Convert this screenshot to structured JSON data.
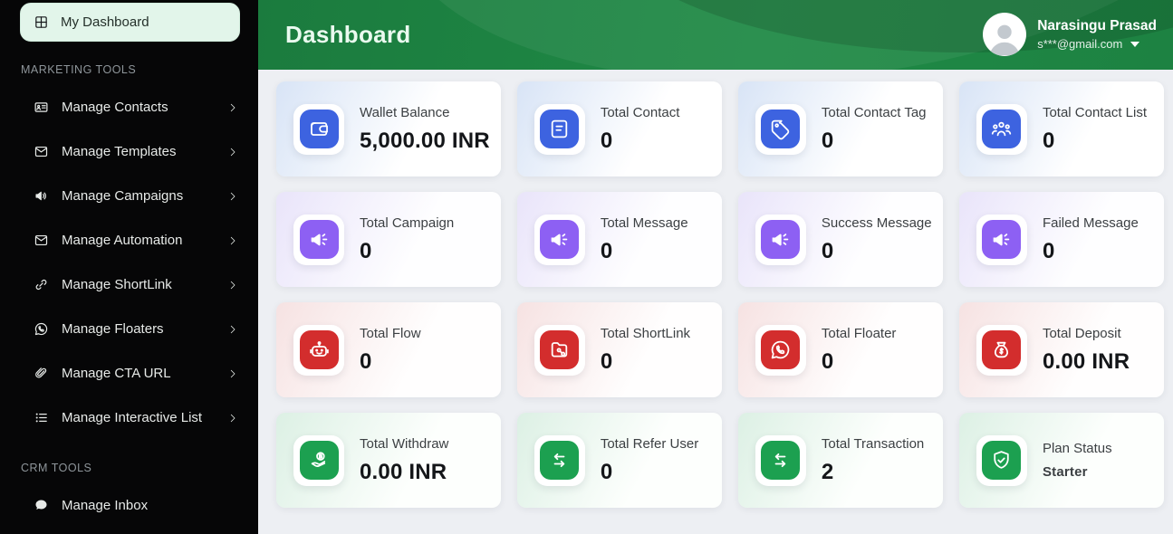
{
  "sidebar": {
    "active_item": {
      "label": "My Dashboard",
      "icon": "dashboard-grid-icon"
    },
    "sections": [
      {
        "title": "MARKETING TOOLS",
        "items": [
          {
            "label": "Manage Contacts",
            "icon": "contact-card-icon",
            "has_submenu": true
          },
          {
            "label": "Manage Templates",
            "icon": "envelope-icon",
            "has_submenu": true
          },
          {
            "label": "Manage Campaigns",
            "icon": "speaker-icon",
            "has_submenu": true
          },
          {
            "label": "Manage Automation",
            "icon": "envelope-icon",
            "has_submenu": true
          },
          {
            "label": "Manage ShortLink",
            "icon": "link-icon",
            "has_submenu": true
          },
          {
            "label": "Manage Floaters",
            "icon": "whatsapp-icon",
            "has_submenu": true
          },
          {
            "label": "Manage CTA URL",
            "icon": "paperclip-icon",
            "has_submenu": true
          },
          {
            "label": "Manage Interactive List",
            "icon": "list-icon",
            "has_submenu": true
          }
        ]
      },
      {
        "title": "CRM TOOLS",
        "items": [
          {
            "label": "Manage Inbox",
            "icon": "chat-bubble-icon",
            "has_submenu": false
          }
        ]
      }
    ]
  },
  "header": {
    "title": "Dashboard",
    "user": {
      "name": "Narasingu Prasad",
      "email": "s***@gmail.com"
    }
  },
  "cards": [
    {
      "title": "Wallet Balance",
      "value": "5,000.00 INR",
      "icon": "wallet-icon",
      "color": "blue"
    },
    {
      "title": "Total Contact",
      "value": "0",
      "icon": "note-icon",
      "color": "blue"
    },
    {
      "title": "Total Contact Tag",
      "value": "0",
      "icon": "tag-icon",
      "color": "blue"
    },
    {
      "title": "Total Contact List",
      "value": "0",
      "icon": "people-group-icon",
      "color": "blue"
    },
    {
      "title": "Total Campaign",
      "value": "0",
      "icon": "megaphone-icon",
      "color": "purple"
    },
    {
      "title": "Total Message",
      "value": "0",
      "icon": "megaphone-icon",
      "color": "purple"
    },
    {
      "title": "Success Message",
      "value": "0",
      "icon": "megaphone-icon",
      "color": "purple"
    },
    {
      "title": "Failed Message",
      "value": "0",
      "icon": "megaphone-icon",
      "color": "purple"
    },
    {
      "title": "Total Flow",
      "value": "0",
      "icon": "robot-icon",
      "color": "red"
    },
    {
      "title": "Total ShortLink",
      "value": "0",
      "icon": "folder-link-icon",
      "color": "red"
    },
    {
      "title": "Total Floater",
      "value": "0",
      "icon": "whatsapp-icon",
      "color": "red"
    },
    {
      "title": "Total Deposit",
      "value": "0.00 INR",
      "icon": "money-bag-icon",
      "color": "red"
    },
    {
      "title": "Total Withdraw",
      "value": "0.00 INR",
      "icon": "hand-coin-icon",
      "color": "green"
    },
    {
      "title": "Total Refer User",
      "value": "0",
      "icon": "transfer-arrows-icon",
      "color": "green"
    },
    {
      "title": "Total Transaction",
      "value": "2",
      "icon": "transfer-arrows-icon",
      "color": "green"
    },
    {
      "title": "Plan Status",
      "value": "Starter",
      "icon": "shield-check-icon",
      "color": "green",
      "value_small": true
    }
  ],
  "colors": {
    "sidebar_bg": "#060607",
    "active_item_bg": "#e2f5ea",
    "header_green": "#1f8a46",
    "page_bg": "#edeff3",
    "accent_blue": "#3d63e0",
    "accent_purple": "#8d60f3",
    "accent_red": "#d32d2d",
    "accent_green": "#1ca050"
  }
}
